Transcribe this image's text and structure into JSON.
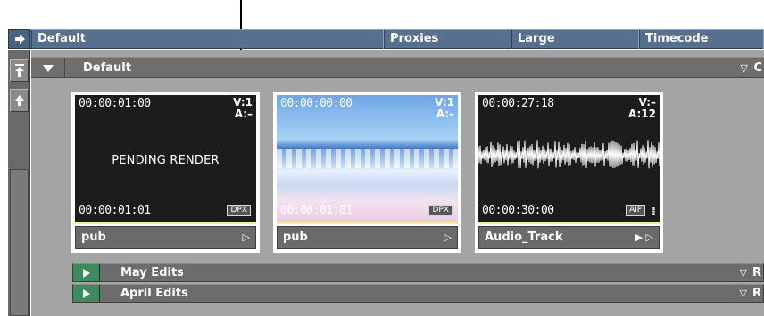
{
  "header": {
    "tabs": [
      {
        "label": "Default"
      },
      {
        "label": "Proxies"
      },
      {
        "label": "Large"
      },
      {
        "label": "Timecode"
      }
    ]
  },
  "bin": {
    "title": "Default",
    "sort_glyph": "▽",
    "col_label": "C"
  },
  "clips": [
    {
      "start_tc": "00:00:01:00",
      "end_tc": "00:00:01:01",
      "v": "V:1",
      "a": "A:–",
      "badge": "DPX",
      "overlay": "PENDING RENDER",
      "name": "pub",
      "play": "▷"
    },
    {
      "start_tc": "00:00:00:00",
      "end_tc": "00:00:01:01",
      "v": "V:1",
      "a": "A:–",
      "badge": "DPX",
      "name": "pub",
      "play": "▷"
    },
    {
      "start_tc": "00:00:27:18",
      "end_tc": "00:00:30:00",
      "v": "V:–",
      "a": "A:12",
      "badge": "AIF",
      "name": "Audio_Track",
      "play": "▶ ▷"
    }
  ],
  "subbins": [
    {
      "label": "May Edits",
      "sort_glyph": "▽",
      "col_label": "R"
    },
    {
      "label": "April Edits",
      "sort_glyph": "▽",
      "col_label": "R"
    }
  ],
  "colors": {
    "header_blue": "#56708d",
    "panel_gray": "#a4a4a4",
    "play_green": "#3c8a5e"
  }
}
